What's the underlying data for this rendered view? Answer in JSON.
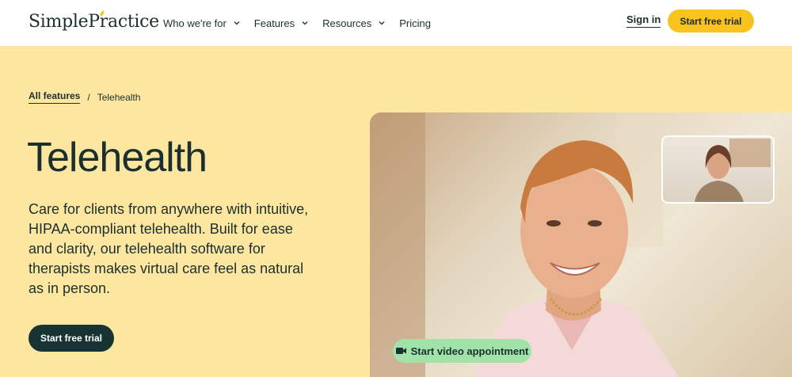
{
  "header": {
    "logo_text": "SimplePractice",
    "nav": [
      {
        "label": "Who we're for",
        "has_dropdown": true
      },
      {
        "label": "Features",
        "has_dropdown": true
      },
      {
        "label": "Resources",
        "has_dropdown": true
      },
      {
        "label": "Pricing",
        "has_dropdown": false
      }
    ],
    "sign_in": "Sign in",
    "cta": "Start free trial"
  },
  "breadcrumb": {
    "parent": "All features",
    "separator": "/",
    "current": "Telehealth"
  },
  "hero": {
    "title": "Telehealth",
    "description": "Care for clients from anywhere with intuitive, HIPAA-compliant telehealth. Built for ease and clarity, our telehealth software for therapists makes virtual care feel as natural as in person.",
    "cta": "Start free trial",
    "video_button": "Start video appointment"
  },
  "colors": {
    "brand_yellow": "#f8c31c",
    "hero_background": "#fde7a0",
    "dark_teal": "#173433",
    "video_pill": "#9fe3a9"
  },
  "icons": {
    "logo_accent": "leaf-icon",
    "dropdown": "chevron-down-icon",
    "video": "video-camera-icon"
  }
}
